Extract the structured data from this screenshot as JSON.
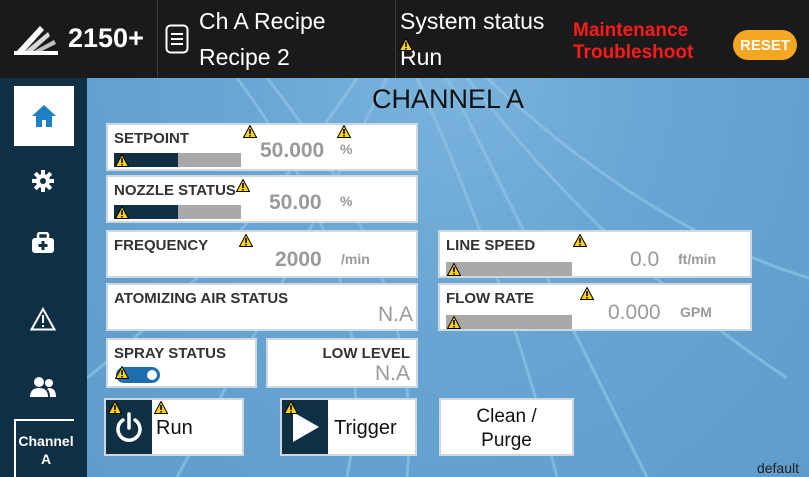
{
  "header": {
    "model": "2150+",
    "recipe_title": "Ch A Recipe",
    "recipe_name": "Recipe 2",
    "status_title": "System status",
    "status_value": "Run",
    "alert_line1": "Maintenance",
    "alert_line2": "Troubleshoot",
    "reset_label": "RESET",
    "colors": {
      "alert": "#ff1a1a",
      "reset": "#f5a623",
      "header_bg": "#1a1a1a"
    }
  },
  "sidebar": {
    "items": [
      {
        "icon": "home-icon"
      },
      {
        "icon": "gear-icon"
      },
      {
        "icon": "toolbox-icon"
      },
      {
        "icon": "warning-icon"
      },
      {
        "icon": "users-icon"
      }
    ],
    "channel_label_1": "Channel",
    "channel_label_2": "A"
  },
  "main": {
    "title": "CHANNEL A",
    "setpoint": {
      "label": "SETPOINT",
      "value": "50.000",
      "unit": "%",
      "level": 0.5
    },
    "nozzle": {
      "label": "NOZZLE STATUS",
      "value": "50.00",
      "unit": "%",
      "level": 0.5
    },
    "frequency": {
      "label": "FREQUENCY",
      "value": "2000",
      "unit": "/min"
    },
    "line_speed": {
      "label": "LINE SPEED",
      "value": "0.0",
      "unit": "ft/min",
      "level": 0
    },
    "air": {
      "label": "ATOMIZING AIR STATUS",
      "value": "N.A"
    },
    "flow": {
      "label": "FLOW RATE",
      "value": "0.000",
      "unit": "GPM",
      "level": 0
    },
    "spray": {
      "label": "SPRAY STATUS",
      "on": true
    },
    "low_level": {
      "label": "LOW LEVEL",
      "value": "N.A"
    },
    "run_label": "Run",
    "trigger_label": "Trigger",
    "clean_line1": "Clean /",
    "clean_line2": "Purge",
    "footer": "default"
  }
}
